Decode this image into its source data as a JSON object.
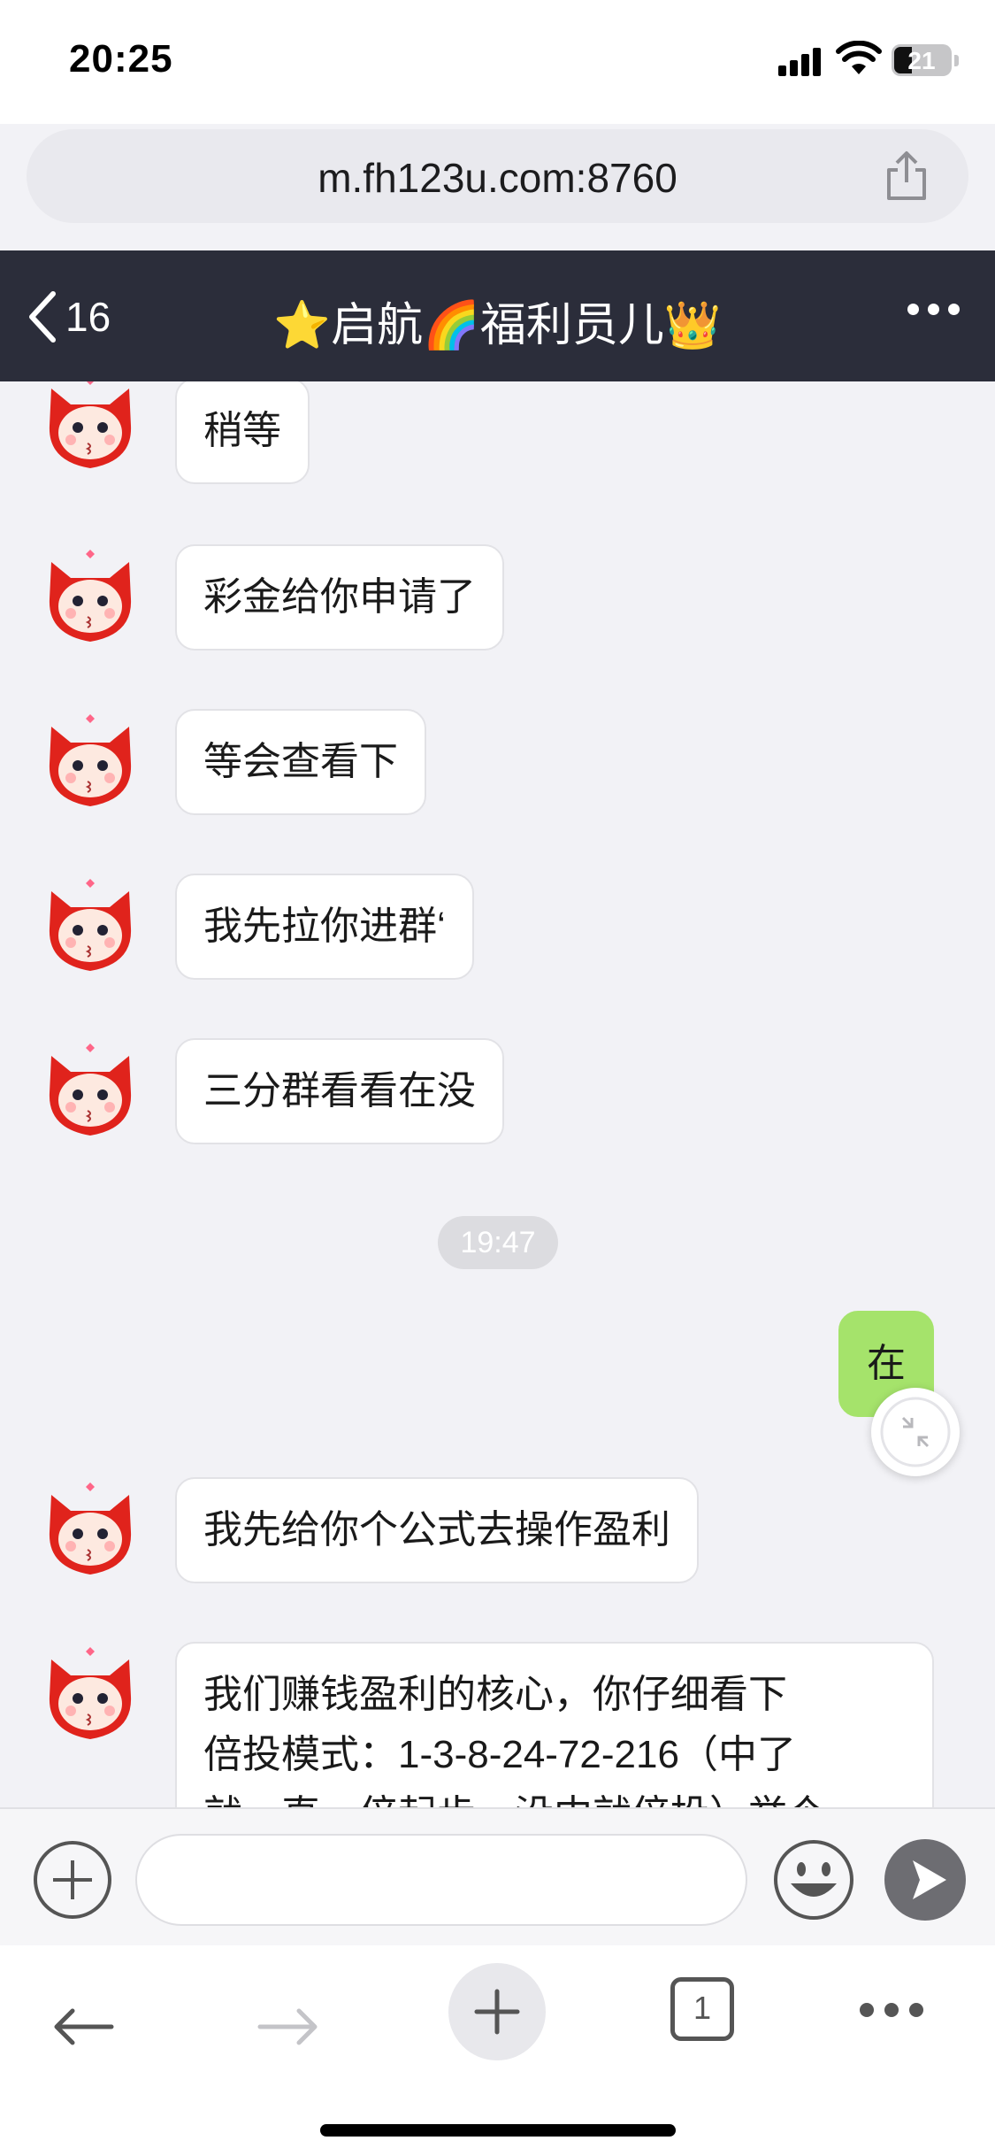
{
  "status_bar": {
    "time": "20:25",
    "battery_level": "21"
  },
  "browser": {
    "url": "m.fh123u.com:8760",
    "tab_count": "1"
  },
  "chat_header": {
    "back_count": "16",
    "title": "⭐启航🌈福利员儿👑"
  },
  "messages": [
    {
      "side": "left",
      "text": "稍等"
    },
    {
      "side": "left",
      "text": "彩金给你申请了"
    },
    {
      "side": "left",
      "text": "等会查看下"
    },
    {
      "side": "left",
      "text": "我先拉你进群‘"
    },
    {
      "side": "left",
      "text": "三分群看看在没"
    },
    {
      "type": "timestamp",
      "text": "19:47"
    },
    {
      "side": "right",
      "text": "在"
    },
    {
      "side": "left",
      "text": "我先给你个公式去操作盈利"
    },
    {
      "side": "left",
      "text_lines": [
        "我们赚钱盈利的核心，你仔细看下",
        "倍投模式：1-3-8-24-72-216（中了",
        "就一直一倍起步，没中就倍投）举个"
      ]
    }
  ],
  "input": {
    "placeholder": ""
  },
  "icons": {
    "back": "chevron-left-icon",
    "more": "more-dots-icon",
    "share": "share-icon",
    "plus": "plus-circle-icon",
    "emoji": "smiley-icon",
    "send": "send-icon",
    "nav_back": "arrow-left-icon",
    "nav_forward": "arrow-right-icon",
    "nav_add": "plus-icon",
    "tabs": "tabs-icon",
    "collapse": "collapse-icon"
  },
  "colors": {
    "header_bg": "#2b2d3a",
    "my_bubble": "#a5e36b",
    "their_bubble": "#ffffff",
    "page_bg": "#f2f2f6"
  }
}
